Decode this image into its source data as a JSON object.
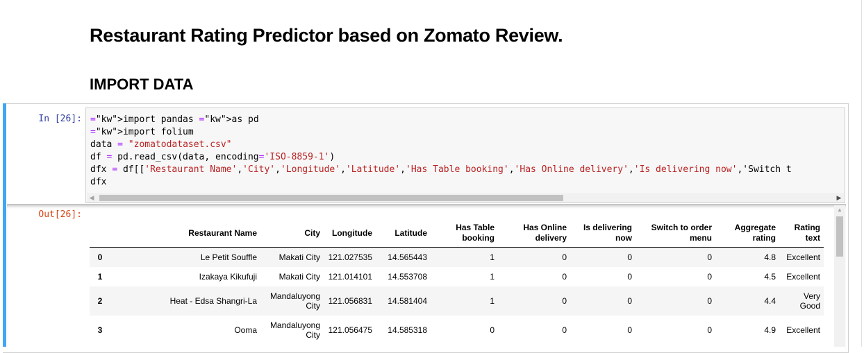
{
  "notebook": {
    "title": "Restaurant Rating Predictor based on Zomato Review.",
    "section_heading": "IMPORT DATA",
    "cell": {
      "in_prompt": "In [26]:",
      "out_prompt": "Out[26]:",
      "code_lines": [
        "import pandas as pd",
        "import folium",
        "data = \"zomatodataset.csv\"",
        "df = pd.read_csv(data, encoding='ISO-8859-1')",
        "dfx = df[['Restaurant Name','City','Longitude','Latitude','Has Table booking','Has Online delivery','Is delivering now','Switch t",
        "dfx"
      ]
    },
    "dataframe": {
      "columns": [
        "",
        "Restaurant Name",
        "City",
        "Longitude",
        "Latitude",
        "Has Table booking",
        "Has Online delivery",
        "Is delivering now",
        "Switch to order menu",
        "Aggregate rating",
        "Rating text"
      ],
      "rows": [
        [
          "0",
          "Le Petit Souffle",
          "Makati City",
          "121.027535",
          "14.565443",
          "1",
          "0",
          "0",
          "0",
          "4.8",
          "Excellent"
        ],
        [
          "1",
          "Izakaya Kikufuji",
          "Makati City",
          "121.014101",
          "14.553708",
          "1",
          "0",
          "0",
          "0",
          "4.5",
          "Excellent"
        ],
        [
          "2",
          "Heat - Edsa Shangri-La",
          "Mandaluyong City",
          "121.056831",
          "14.581404",
          "1",
          "0",
          "0",
          "0",
          "4.4",
          "Very Good"
        ],
        [
          "3",
          "Ooma",
          "Mandaluyong City",
          "121.056475",
          "14.585318",
          "0",
          "0",
          "0",
          "0",
          "4.9",
          "Excellent"
        ]
      ]
    }
  },
  "colors": {
    "cell_active_bar": "#42a5f5",
    "in_prompt": "#303f9f",
    "out_prompt": "#d84315",
    "keyword": "#008000",
    "string": "#ba2121"
  }
}
